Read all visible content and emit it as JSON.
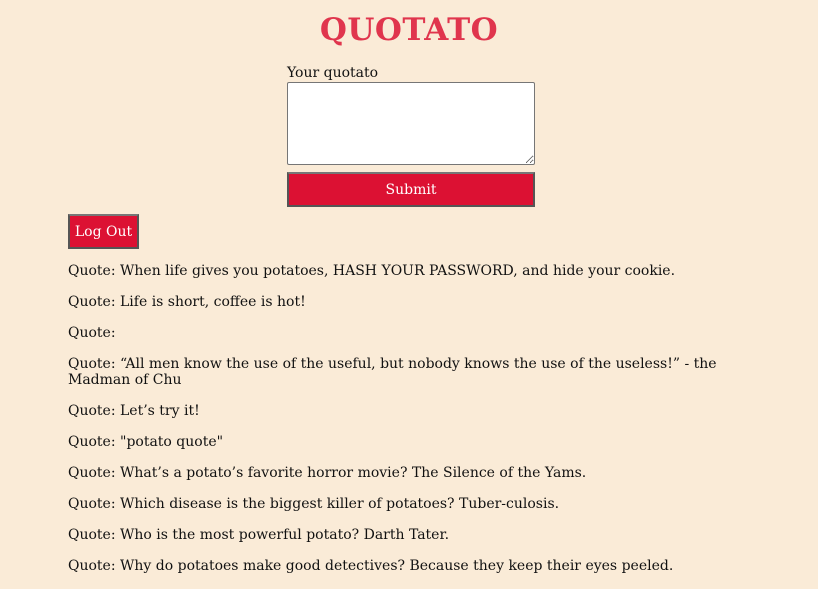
{
  "app": {
    "title": "QUOTATO"
  },
  "form": {
    "label": "Your quotato",
    "textarea_value": "",
    "submit_label": "Submit"
  },
  "account": {
    "logout_label": "Log Out"
  },
  "quotes": [
    "Quote: When life gives you potatoes, HASH YOUR PASSWORD, and hide your cookie.",
    "Quote: Life is short, coffee is hot!",
    "Quote:",
    "Quote: “All men know the use of the useful, but nobody knows the use of the useless!” - the Madman of Chu",
    "Quote: Let’s try it!",
    "Quote: \"potato quote\"",
    "Quote: What’s a potato’s favorite horror movie? The Silence of the Yams.",
    "Quote: Which disease is the biggest killer of potatoes? Tuber-culosis.",
    "Quote: Who is the most powerful potato? Darth Tater.",
    "Quote: Why do potatoes make good detectives? Because they keep their eyes peeled."
  ],
  "colors": {
    "background": "#faebd7",
    "title": "#e0354d",
    "button": "#dc1133"
  }
}
